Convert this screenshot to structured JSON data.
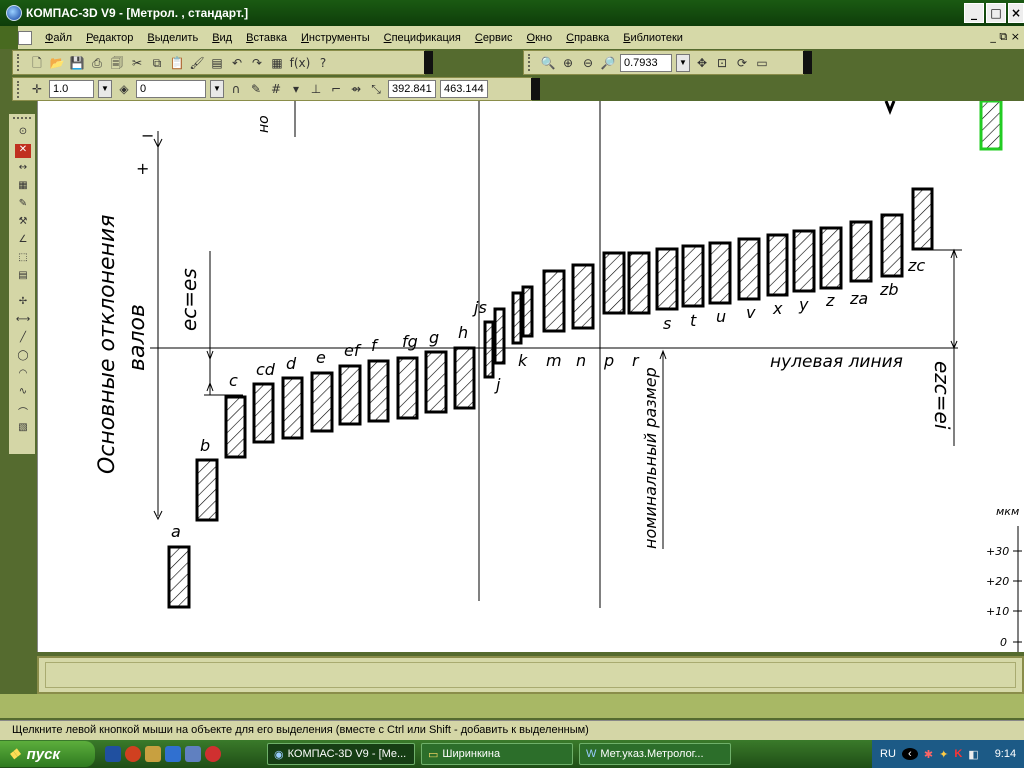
{
  "window": {
    "title": "КОМПАС-3D V9 - [Метрол. , стандарт.]"
  },
  "menu": [
    "Файл",
    "Редактор",
    "Выделить",
    "Вид",
    "Вставка",
    "Инструменты",
    "Спецификация",
    "Сервис",
    "Окно",
    "Справка",
    "Библиотеки"
  ],
  "toolbar": {
    "zoom_value": "0.7933",
    "line_width": "1.0",
    "layer": "0",
    "coord_x": "392.841",
    "coord_y": "463.144"
  },
  "drawing": {
    "title_line1": "Основные отклонения",
    "title_line2": "валов",
    "minus": "−",
    "plus": "+",
    "es_label": "eᴄ=es",
    "ei_label": "eᴢᴄ=ei",
    "zero_line": "нулевая линия",
    "nominal": "номинальный размер",
    "partial_top": "но",
    "letters_low": [
      "a",
      "b",
      "c",
      "cd",
      "d",
      "e",
      "ef",
      "f",
      "fg",
      "g",
      "h",
      "js",
      "j",
      "k",
      "m",
      "n",
      "p",
      "r"
    ],
    "letters_high": [
      "s",
      "t",
      "u",
      "v",
      "x",
      "y",
      "z",
      "za",
      "zb",
      "zc"
    ],
    "scale_unit": "мкм",
    "scale_ticks": [
      "+30",
      "+20",
      "+10",
      "0"
    ]
  },
  "statusbar": {
    "text": "Щелкните левой кнопкой мыши на объекте для его выделения (вместе с Ctrl или Shift - добавить к выделенным)"
  },
  "taskbar": {
    "start": "пуск",
    "items": [
      "КОМПАС-3D V9 - [Ме...",
      "Ширинкина",
      "Мет.указ.Метролог..."
    ],
    "lang": "RU",
    "clock": "9:14"
  }
}
